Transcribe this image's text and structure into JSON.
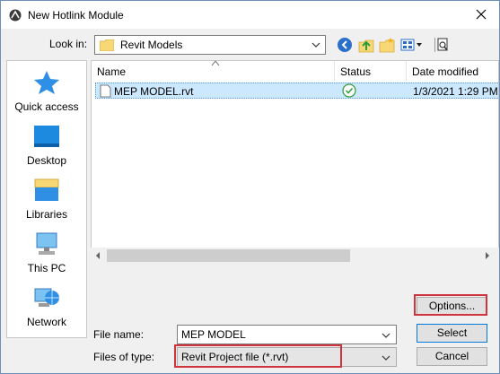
{
  "window": {
    "title": "New Hotlink Module"
  },
  "toolbar": {
    "look_in_label": "Look in:",
    "look_in_value": "Revit Models",
    "icons": [
      "back-icon",
      "up-folder-icon",
      "new-folder-icon",
      "views-menu-icon",
      "preview-icon"
    ]
  },
  "places": {
    "items": [
      {
        "label": "Quick access",
        "icon": "star-icon"
      },
      {
        "label": "Desktop",
        "icon": "desktop-icon"
      },
      {
        "label": "Libraries",
        "icon": "libraries-icon"
      },
      {
        "label": "This PC",
        "icon": "computer-icon"
      },
      {
        "label": "Network",
        "icon": "network-icon"
      }
    ]
  },
  "file_list": {
    "columns": [
      "Name",
      "Status",
      "Date modified"
    ],
    "rows": [
      {
        "name": "MEP MODEL.rvt",
        "status": "check-icon",
        "date": "1/3/2021 1:29 PM"
      }
    ]
  },
  "form": {
    "file_name_label": "File name:",
    "file_name_value": "MEP MODEL",
    "file_type_label": "Files of type:",
    "file_type_value": "Revit Project file (*.rvt)"
  },
  "buttons": {
    "options": "Options...",
    "select": "Select",
    "cancel": "Cancel"
  },
  "colors": {
    "accent": "#0078d7",
    "selection": "#cce8ff",
    "highlight": "#d0343d",
    "folder": "#f8d775"
  }
}
